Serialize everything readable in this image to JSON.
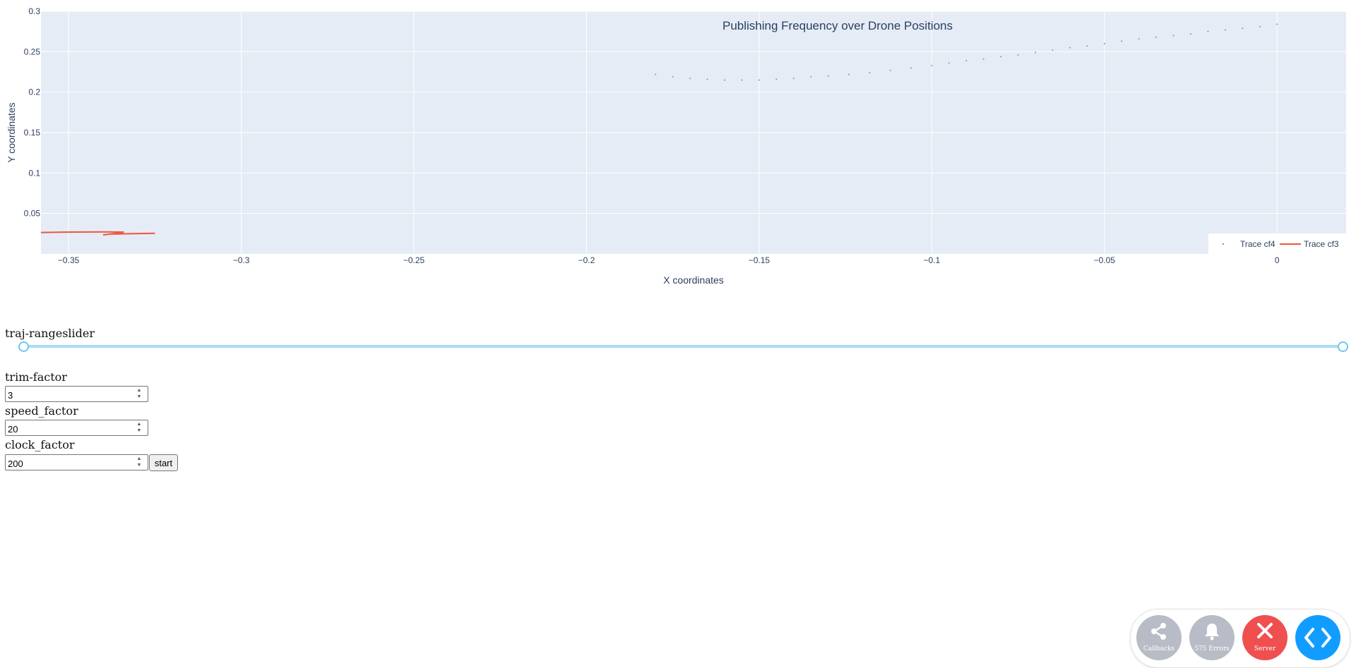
{
  "chart_data": {
    "type": "scatter",
    "title": "Publishing Frequency over Drone Positions",
    "xlabel": "X coordinates",
    "ylabel": "Y coordinates",
    "xlim": [
      -0.358,
      0.02
    ],
    "ylim": [
      0.0,
      0.3
    ],
    "x_ticks": [
      -0.35,
      -0.3,
      -0.25,
      -0.2,
      -0.15,
      -0.1,
      -0.05,
      0
    ],
    "x_tick_labels": [
      "−0.35",
      "−0.3",
      "−0.25",
      "−0.2",
      "−0.15",
      "−0.1",
      "−0.05",
      "0"
    ],
    "y_ticks": [
      0.05,
      0.1,
      0.15,
      0.2,
      0.25,
      0.3
    ],
    "y_tick_labels": [
      "0.05",
      "0.1",
      "0.15",
      "0.2",
      "0.25",
      "0.3"
    ],
    "grid": true,
    "legend_position": "bottom-right",
    "series": [
      {
        "name": "Trace cf4",
        "mode": "markers",
        "color": "#8a90a8",
        "x": [
          -0.18,
          -0.175,
          -0.17,
          -0.165,
          -0.16,
          -0.155,
          -0.15,
          -0.145,
          -0.14,
          -0.135,
          -0.13,
          -0.124,
          -0.118,
          -0.112,
          -0.106,
          -0.1,
          -0.095,
          -0.09,
          -0.085,
          -0.08,
          -0.075,
          -0.07,
          -0.065,
          -0.06,
          -0.055,
          -0.05,
          -0.045,
          -0.04,
          -0.035,
          -0.03,
          -0.025,
          -0.02,
          -0.015,
          -0.01,
          -0.005,
          0
        ],
        "y": [
          0.222,
          0.219,
          0.217,
          0.216,
          0.215,
          0.215,
          0.215,
          0.216,
          0.217,
          0.219,
          0.22,
          0.222,
          0.224,
          0.227,
          0.23,
          0.233,
          0.236,
          0.239,
          0.241,
          0.244,
          0.246,
          0.249,
          0.252,
          0.255,
          0.257,
          0.26,
          0.263,
          0.266,
          0.268,
          0.27,
          0.272,
          0.275,
          0.277,
          0.279,
          0.281,
          0.284
        ]
      },
      {
        "name": "Trace cf3",
        "mode": "lines",
        "color": "#ef553b",
        "x": [
          -0.358,
          -0.35,
          -0.34,
          -0.334,
          -0.336,
          -0.34,
          -0.338,
          -0.33,
          -0.325
        ],
        "y": [
          0.0265,
          0.027,
          0.0272,
          0.027,
          0.0255,
          0.0235,
          0.0245,
          0.0252,
          0.0255
        ]
      }
    ]
  },
  "controls": {
    "rangeslider_label": "traj-rangeslider",
    "trim_label": "trim-factor",
    "trim_value": "3",
    "speed_label": "speed_factor",
    "speed_value": "20",
    "clock_label": "clock_factor",
    "clock_value": "200",
    "start_label": "start"
  },
  "devtools": {
    "callbacks_label": "Callbacks",
    "errors_label": "575 Errors",
    "server_label": "Server",
    "colors": {
      "gray": "#b8bcc6",
      "red": "#ef4f4f",
      "blue": "#119dff"
    }
  }
}
